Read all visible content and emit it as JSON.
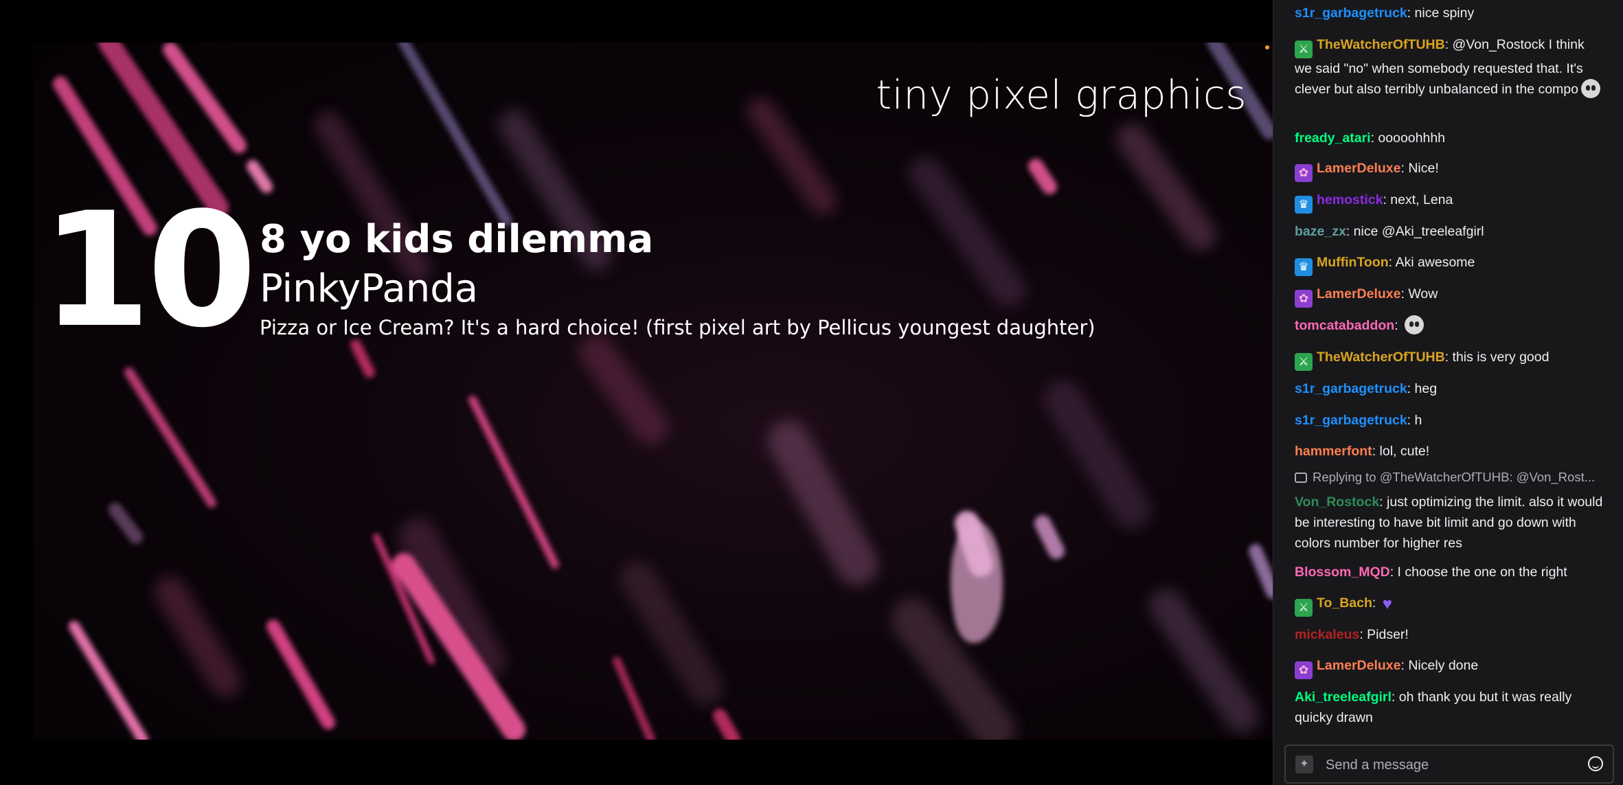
{
  "video": {
    "overlay_title": "tiny pixel graphics",
    "entry_number": "10",
    "entry_title": "8 yo kids dilemma",
    "entry_author": "PinkyPanda",
    "entry_description": "Pizza or Ice Cream? It's a hard choice! (first pixel art by Pellicus youngest daughter)"
  },
  "chat": {
    "messages": [
      {
        "badge": "",
        "user": "s1r_garbagetruck",
        "color": "#1e90ff",
        "text": "nice spiny",
        "emote": ""
      },
      {
        "badge": "sword-badge",
        "user": "TheWatcherOfTUHB",
        "color": "#daa520",
        "text": "@Von_Rostock I think we said \"no\" when somebody requested that. It's clever but also terribly unbalanced in the compo",
        "emote": "skull"
      },
      {
        "badge": "",
        "user": "fready_atari",
        "color": "#00ff7f",
        "text": "ooooohhhh",
        "emote": ""
      },
      {
        "badge": "flower-badge",
        "user": "LamerDeluxe",
        "color": "#ff7f50",
        "text": "Nice!",
        "emote": ""
      },
      {
        "badge": "crown-badge",
        "user": "hemostick",
        "color": "#8a2be2",
        "text": "next, Lena",
        "emote": ""
      },
      {
        "badge": "",
        "user": "baze_zx",
        "color": "#5f9ea0",
        "text": "nice @Aki_treeleafgirl",
        "emote": ""
      },
      {
        "badge": "crown-badge",
        "user": "MuffinToon",
        "color": "#daa520",
        "text": "Aki awesome",
        "emote": ""
      },
      {
        "badge": "flower-badge",
        "user": "LamerDeluxe",
        "color": "#ff7f50",
        "text": "Wow",
        "emote": ""
      },
      {
        "badge": "",
        "user": "tomcatabaddon",
        "color": "#ff69b4",
        "text": "",
        "emote": "skull"
      },
      {
        "badge": "sword-badge",
        "user": "TheWatcherOfTUHB",
        "color": "#daa520",
        "text": "this is very good",
        "emote": ""
      },
      {
        "badge": "",
        "user": "s1r_garbagetruck",
        "color": "#1e90ff",
        "text": "heg",
        "emote": ""
      },
      {
        "badge": "",
        "user": "s1r_garbagetruck",
        "color": "#1e90ff",
        "text": "h",
        "emote": ""
      },
      {
        "badge": "",
        "user": "hammerfont",
        "color": "#ff7f50",
        "text": "lol, cute!",
        "emote": ""
      },
      {
        "badge": "",
        "user": "Von_Rostock",
        "color": "#2e8b57",
        "text": "just optimizing the limit. also it would be interesting to have bit limit and go down with colors number for higher res",
        "emote": ""
      },
      {
        "badge": "",
        "user": "Blossom_MQD",
        "color": "#ff69b4",
        "text": "I choose the one on the right",
        "emote": ""
      },
      {
        "badge": "sword-badge",
        "user": "To_Bach",
        "color": "#daa520",
        "text": "",
        "emote": "heart"
      },
      {
        "badge": "",
        "user": "mickaleus",
        "color": "#b22222",
        "text": "Pidser!",
        "emote": ""
      },
      {
        "badge": "flower-badge",
        "user": "LamerDeluxe",
        "color": "#ff7f50",
        "text": "Nicely done",
        "emote": ""
      },
      {
        "badge": "",
        "user": "Aki_treeleafgirl",
        "color": "#00ff7f",
        "text": "oh thank you but it was really quicky drawn",
        "emote": ""
      }
    ],
    "reply_text": "Replying to @TheWatcherOfTUHB: @Von_Rost...",
    "input_placeholder": "Send a message"
  }
}
